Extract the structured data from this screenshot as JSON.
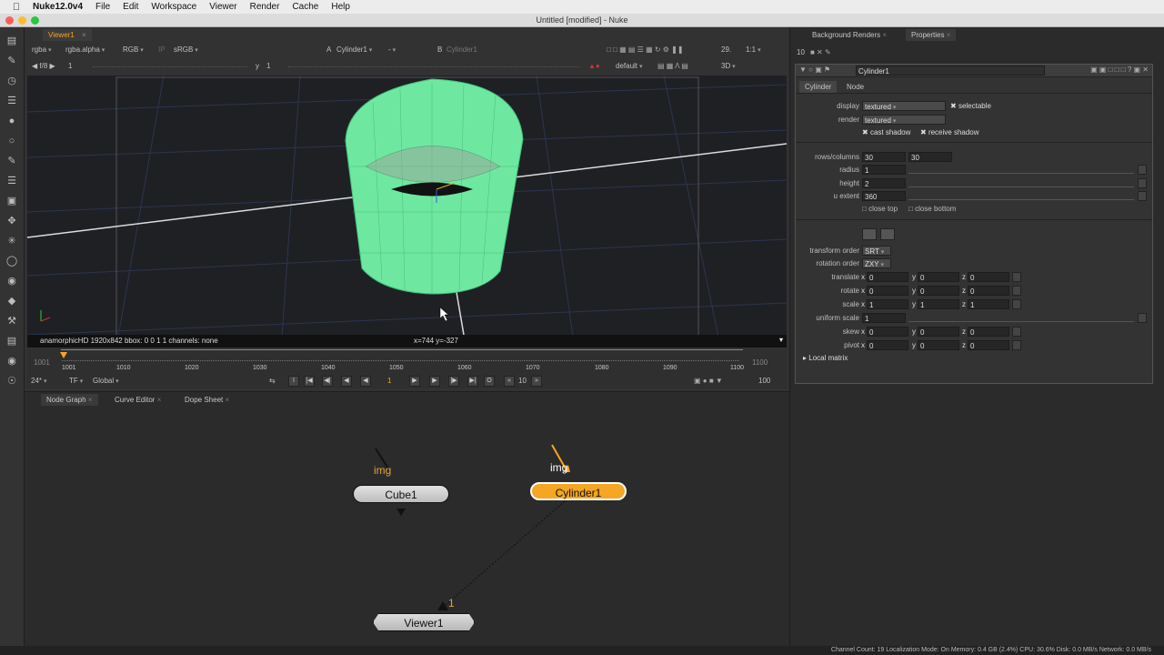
{
  "menubar": {
    "app_name": "Nuke12.0v4",
    "items": [
      "File",
      "Edit",
      "Workspace",
      "Viewer",
      "Render",
      "Cache",
      "Help"
    ]
  },
  "window": {
    "title": "Untitled [modified] - Nuke"
  },
  "viewer": {
    "tab_label": "Viewer1",
    "channels": "rgba",
    "alpha": "rgba.alpha",
    "colorspace_mode": "RGB",
    "ip_label": "IP",
    "lut": "sRGB",
    "input_a_label": "A",
    "input_a": "Cylinder1",
    "input_a_op": "-",
    "input_b_label": "B",
    "input_b": "Cylinder1",
    "fps": "29.",
    "scale": "1:1",
    "fstop": "f/8",
    "frame_field": "1",
    "y_label": "y",
    "y_value": "1",
    "camera": "default",
    "view_mode": "3D",
    "info_format": "anamorphicHD 1920x842  bbox: 0 0 1 1 channels: none",
    "info_coords": "x=744 y=-327",
    "timeline": {
      "start": "1001",
      "end": "1100",
      "ticks": [
        "1001",
        "1010",
        "1020",
        "1030",
        "1040",
        "1050",
        "1060",
        "1070",
        "1080",
        "1090",
        "1100"
      ]
    },
    "transport": {
      "fps_rate": "24*",
      "tf": "TF",
      "global": "Global",
      "current_frame": "1",
      "step": "10",
      "end_frame": "100"
    }
  },
  "node_graph": {
    "tabs": [
      "Node Graph",
      "Curve Editor",
      "Dope Sheet"
    ],
    "nodes": {
      "cube": "Cube1",
      "cylinder": "Cylinder1",
      "viewer": "Viewer1"
    },
    "input_label": "img",
    "viewer_input": "1"
  },
  "properties": {
    "tabs": [
      "Background Renders",
      "Properties"
    ],
    "max_panels": "10",
    "node_name": "Cylinder1",
    "inner_tabs": [
      "Cylinder",
      "Node"
    ],
    "display_label": "display",
    "display_value": "textured",
    "selectable_label": "selectable",
    "render_label": "render",
    "render_value": "textured",
    "cast_shadow_label": "cast shadow",
    "receive_shadow_label": "receive shadow",
    "rows_columns_label": "rows/columns",
    "rows": "30",
    "columns": "30",
    "radius_label": "radius",
    "radius": "1",
    "height_label": "height",
    "height": "2",
    "u_extent_label": "u extent",
    "u_extent": "360",
    "close_top_label": "close top",
    "close_bottom_label": "close bottom",
    "transform_order_label": "transform order",
    "transform_order": "SRT",
    "rotation_order_label": "rotation order",
    "rotation_order": "ZXY",
    "translate_label": "translate",
    "rotate_label": "rotate",
    "scale_label": "scale",
    "uniform_scale_label": "uniform scale",
    "uniform_scale": "1",
    "skew_label": "skew",
    "pivot_label": "pivot",
    "local_matrix_label": "Local matrix",
    "xyz": {
      "translate": [
        "0",
        "0",
        "0"
      ],
      "rotate": [
        "0",
        "0",
        "0"
      ],
      "scale": [
        "1",
        "1",
        "1"
      ],
      "skew": [
        "0",
        "0",
        "0"
      ],
      "pivot": [
        "0",
        "0",
        "0"
      ]
    },
    "axis": [
      "x",
      "y",
      "z"
    ]
  },
  "status": "Channel Count: 19  Localization Mode: On  Memory: 0.4 GB (2.4%)  CPU: 30.6%  Disk: 0.0 MB/s  Network: 0.0 MB/s",
  "colors": {
    "accent_orange": "#f5a623",
    "cylinder_green": "#6ee8a0",
    "node_gray": "#cfcfcf"
  }
}
